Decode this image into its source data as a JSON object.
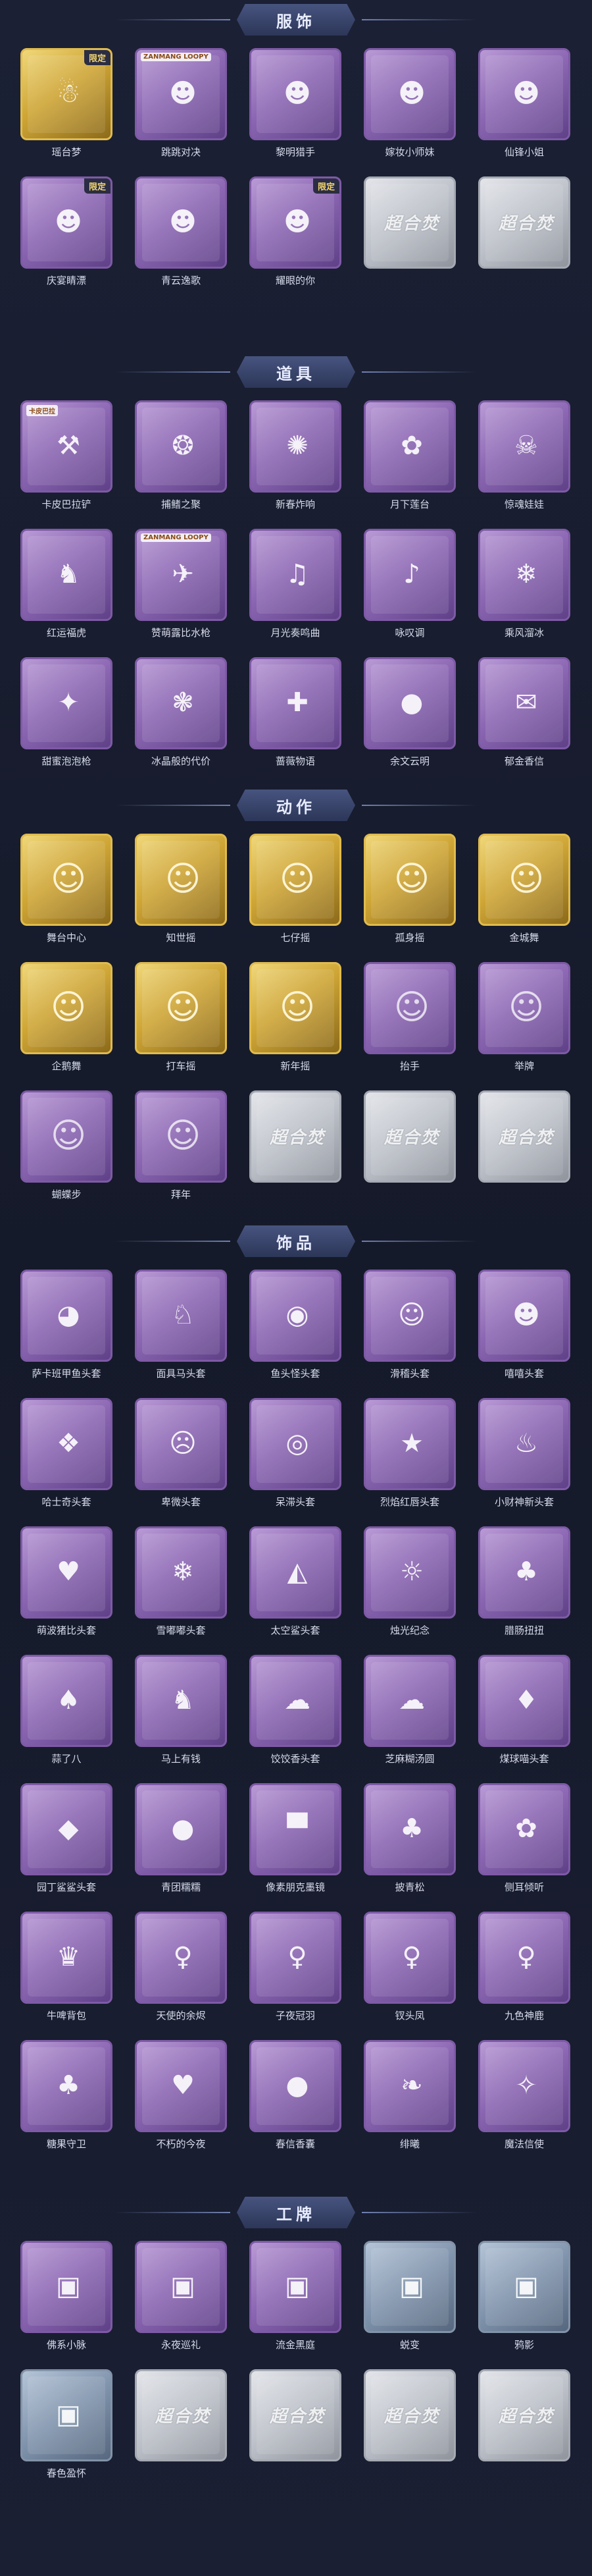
{
  "sections": [
    {
      "key": "clothing",
      "title": "服饰",
      "items": [
        {
          "label": "瑶台梦",
          "frame": "gold",
          "icon": "outfit-portrait",
          "glyph": "☃",
          "badge": "限定"
        },
        {
          "label": "跳跳对决",
          "frame": "purple",
          "icon": "outfit-portrait",
          "glyph": "☻",
          "tag": "ZANMANG LOOPY"
        },
        {
          "label": "黎明猎手",
          "frame": "purple",
          "icon": "outfit-portrait",
          "glyph": "☻"
        },
        {
          "label": "嫁妆小师妹",
          "frame": "purple",
          "icon": "outfit-portrait",
          "glyph": "☻"
        },
        {
          "label": "仙锋小姐",
          "frame": "purple",
          "icon": "outfit-portrait",
          "glyph": "☻"
        },
        {
          "label": "庆宴睛漂",
          "frame": "purple",
          "icon": "outfit-portrait",
          "glyph": "☻",
          "badge": "限定"
        },
        {
          "label": "青云逸歌",
          "frame": "purple",
          "icon": "outfit-portrait",
          "glyph": "☻"
        },
        {
          "label": "耀眼的你",
          "frame": "purple",
          "icon": "outfit-portrait",
          "glyph": "☻",
          "badge": "限定"
        },
        {
          "label": "",
          "frame": "silver",
          "icon": "empty-slot",
          "glyph": "超合焚"
        },
        {
          "label": "",
          "frame": "silver",
          "icon": "empty-slot",
          "glyph": "超合焚"
        }
      ]
    },
    {
      "key": "props",
      "title": "道具",
      "items": [
        {
          "label": "卡皮巴拉铲",
          "frame": "purple",
          "icon": "capybara-shovel",
          "glyph": "⚒",
          "tag": "卡皮巴拉"
        },
        {
          "label": "捕鳍之聚",
          "frame": "purple",
          "icon": "prayer-beads",
          "glyph": "❂"
        },
        {
          "label": "新春炸响",
          "frame": "purple",
          "icon": "firecracker",
          "glyph": "✺"
        },
        {
          "label": "月下莲台",
          "frame": "purple",
          "icon": "lantern-staff",
          "glyph": "✿"
        },
        {
          "label": "惊魂娃娃",
          "frame": "purple",
          "icon": "skull-doll",
          "glyph": "☠"
        },
        {
          "label": "红运福虎",
          "frame": "purple",
          "icon": "tiger-toy",
          "glyph": "♞"
        },
        {
          "label": "赞萌露比水枪",
          "frame": "purple",
          "icon": "water-gun",
          "glyph": "✈",
          "tag": "ZANMANG LOOPY"
        },
        {
          "label": "月光奏鸣曲",
          "frame": "purple",
          "icon": "piano",
          "glyph": "♫"
        },
        {
          "label": "咏叹调",
          "frame": "purple",
          "icon": "music-box",
          "glyph": "♪"
        },
        {
          "label": "乘风溜冰",
          "frame": "purple",
          "icon": "roller-skates",
          "glyph": "❄"
        },
        {
          "label": "甜蜜泡泡枪",
          "frame": "purple",
          "icon": "bubble-gun",
          "glyph": "✦"
        },
        {
          "label": "冰晶般的代价",
          "frame": "purple",
          "icon": "ice-flower",
          "glyph": "❃"
        },
        {
          "label": "蔷薇物语",
          "frame": "purple",
          "icon": "medical-kit",
          "glyph": "✚"
        },
        {
          "label": "余文云明",
          "frame": "purple",
          "icon": "grenade",
          "glyph": "●"
        },
        {
          "label": "郁金香信",
          "frame": "purple",
          "icon": "letter",
          "glyph": "✉"
        }
      ]
    },
    {
      "key": "actions",
      "title": "动作",
      "items": [
        {
          "label": "舞台中心",
          "frame": "gold",
          "icon": "action-silhouette",
          "glyph": "☺"
        },
        {
          "label": "知世摇",
          "frame": "gold",
          "icon": "action-silhouette",
          "glyph": "☺"
        },
        {
          "label": "七仔摇",
          "frame": "gold",
          "icon": "action-silhouette",
          "glyph": "☺"
        },
        {
          "label": "孤身摇",
          "frame": "gold",
          "icon": "action-silhouette",
          "glyph": "☺"
        },
        {
          "label": "金城舞",
          "frame": "gold",
          "icon": "action-silhouette",
          "glyph": "☺"
        },
        {
          "label": "企鹅舞",
          "frame": "gold",
          "icon": "action-silhouette",
          "glyph": "☺"
        },
        {
          "label": "打车摇",
          "frame": "gold",
          "icon": "action-silhouette",
          "glyph": "☺"
        },
        {
          "label": "新年摇",
          "frame": "gold",
          "icon": "action-silhouette",
          "glyph": "☺"
        },
        {
          "label": "抬手",
          "frame": "purple",
          "icon": "action-silhouette",
          "glyph": "☺"
        },
        {
          "label": "举牌",
          "frame": "purple",
          "icon": "action-silhouette",
          "glyph": "☺"
        },
        {
          "label": "蝴蝶步",
          "frame": "purple",
          "icon": "action-silhouette",
          "glyph": "☺"
        },
        {
          "label": "拜年",
          "frame": "purple",
          "icon": "action-silhouette",
          "glyph": "☺"
        },
        {
          "label": "",
          "frame": "silver",
          "icon": "empty-slot",
          "glyph": "超合焚"
        },
        {
          "label": "",
          "frame": "silver",
          "icon": "empty-slot",
          "glyph": "超合焚"
        },
        {
          "label": "",
          "frame": "silver",
          "icon": "empty-slot",
          "glyph": "超合焚"
        }
      ]
    },
    {
      "key": "accessories",
      "title": "饰品",
      "items": [
        {
          "label": "萨卡班甲鱼头套",
          "frame": "purple",
          "icon": "fish-mask",
          "glyph": "◕"
        },
        {
          "label": "面具马头套",
          "frame": "purple",
          "icon": "horse-mask",
          "glyph": "♘"
        },
        {
          "label": "鱼头怪头套",
          "frame": "purple",
          "icon": "fish-head-mask",
          "glyph": "◉"
        },
        {
          "label": "滑稽头套",
          "frame": "purple",
          "icon": "smirk-emoji-mask",
          "glyph": "☺"
        },
        {
          "label": "嘻嘻头套",
          "frame": "purple",
          "icon": "grin-emoji-mask",
          "glyph": "☻"
        },
        {
          "label": "哈士奇头套",
          "frame": "purple",
          "icon": "husky-mask",
          "glyph": "❖"
        },
        {
          "label": "卑微头套",
          "frame": "purple",
          "icon": "sad-emoji-mask",
          "glyph": "☹"
        },
        {
          "label": "呆滞头套",
          "frame": "purple",
          "icon": "dazed-emoji-mask",
          "glyph": "◎"
        },
        {
          "label": "烈焰红唇头套",
          "frame": "purple",
          "icon": "pikachu-mask",
          "glyph": "★"
        },
        {
          "label": "小财神新头套",
          "frame": "purple",
          "icon": "poop-mask",
          "glyph": "♨"
        },
        {
          "label": "萌波猪比头套",
          "frame": "purple",
          "icon": "pig-mask",
          "glyph": "♥"
        },
        {
          "label": "雪嘟嘟头套",
          "frame": "purple",
          "icon": "snowman-mask",
          "glyph": "❄"
        },
        {
          "label": "太空鲨头套",
          "frame": "purple",
          "icon": "shark-mask",
          "glyph": "◭"
        },
        {
          "label": "烛光纪念",
          "frame": "purple",
          "icon": "candle-mask",
          "glyph": "☼"
        },
        {
          "label": "腊肠扭扭",
          "frame": "purple",
          "icon": "dachshund-mask",
          "glyph": "♣"
        },
        {
          "label": "蒜了八",
          "frame": "purple",
          "icon": "garlic-mask",
          "glyph": "♠"
        },
        {
          "label": "马上有钱",
          "frame": "purple",
          "icon": "horse-toy",
          "glyph": "♞"
        },
        {
          "label": "饺饺香头套",
          "frame": "purple",
          "icon": "dumpling-mask",
          "glyph": "☁"
        },
        {
          "label": "芝麻糊汤圆",
          "frame": "purple",
          "icon": "tangyuan-mask",
          "glyph": "☁"
        },
        {
          "label": "煤球喵头套",
          "frame": "purple",
          "icon": "cat-mask",
          "glyph": "♦"
        },
        {
          "label": "园丁鲨鲨头套",
          "frame": "purple",
          "icon": "shark-gardener",
          "glyph": "◆"
        },
        {
          "label": "青团糯糯",
          "frame": "purple",
          "icon": "qingtuan-mask",
          "glyph": "●"
        },
        {
          "label": "像素朋克墨镜",
          "frame": "purple",
          "icon": "pixel-sunglasses",
          "glyph": "▀"
        },
        {
          "label": "披青松",
          "frame": "purple",
          "icon": "bonsai-tree",
          "glyph": "♣"
        },
        {
          "label": "侧耳倾听",
          "frame": "purple",
          "icon": "flower-wreath",
          "glyph": "✿"
        },
        {
          "label": "牛啤背包",
          "frame": "purple",
          "icon": "cake-backpack",
          "glyph": "♛"
        },
        {
          "label": "天使的余烬",
          "frame": "purple",
          "icon": "angel-figure",
          "glyph": "♀"
        },
        {
          "label": "子夜冠羽",
          "frame": "purple",
          "icon": "feather-figure",
          "glyph": "♀"
        },
        {
          "label": "钗头凤",
          "frame": "purple",
          "icon": "phoenix-hairpin",
          "glyph": "♀"
        },
        {
          "label": "九色神鹿",
          "frame": "purple",
          "icon": "deer-figure",
          "glyph": "♀"
        },
        {
          "label": "糖果守卫",
          "frame": "purple",
          "icon": "candy-guard",
          "glyph": "♣"
        },
        {
          "label": "不朽的今夜",
          "frame": "purple",
          "icon": "ribbon-doll",
          "glyph": "♥"
        },
        {
          "label": "春信香囊",
          "frame": "purple",
          "icon": "sachet",
          "glyph": "●"
        },
        {
          "label": "绯曦",
          "frame": "purple",
          "icon": "tassel-charm",
          "glyph": "❧"
        },
        {
          "label": "魔法信使",
          "frame": "purple",
          "icon": "mouse-mage",
          "glyph": "✧"
        }
      ]
    },
    {
      "key": "badges",
      "title": "工牌",
      "items": [
        {
          "label": "佛系小脉",
          "frame": "purple",
          "icon": "badge-card",
          "glyph": "▣"
        },
        {
          "label": "永夜巡礼",
          "frame": "purple",
          "icon": "badge-card",
          "glyph": "▣"
        },
        {
          "label": "流金黑庭",
          "frame": "purple",
          "icon": "badge-card",
          "glyph": "▣"
        },
        {
          "label": "蜕变",
          "frame": "teal",
          "icon": "badge-card",
          "glyph": "▣"
        },
        {
          "label": "鸦影",
          "frame": "teal",
          "icon": "badge-card",
          "glyph": "▣"
        },
        {
          "label": "春色盈怀",
          "frame": "teal",
          "icon": "badge-card",
          "glyph": "▣"
        },
        {
          "label": "",
          "frame": "silver",
          "icon": "empty-slot",
          "glyph": "超合焚"
        },
        {
          "label": "",
          "frame": "silver",
          "icon": "empty-slot",
          "glyph": "超合焚"
        },
        {
          "label": "",
          "frame": "silver",
          "icon": "empty-slot",
          "glyph": "超合焚"
        },
        {
          "label": "",
          "frame": "silver",
          "icon": "empty-slot",
          "glyph": "超合焚"
        }
      ]
    }
  ],
  "colors": {
    "background": "#161a2b",
    "header": "#3a4570",
    "purple_frame": "#8d68b4",
    "gold_frame": "#cfa636",
    "silver_frame": "#bcc0c8",
    "label": "#d7dbeb"
  }
}
